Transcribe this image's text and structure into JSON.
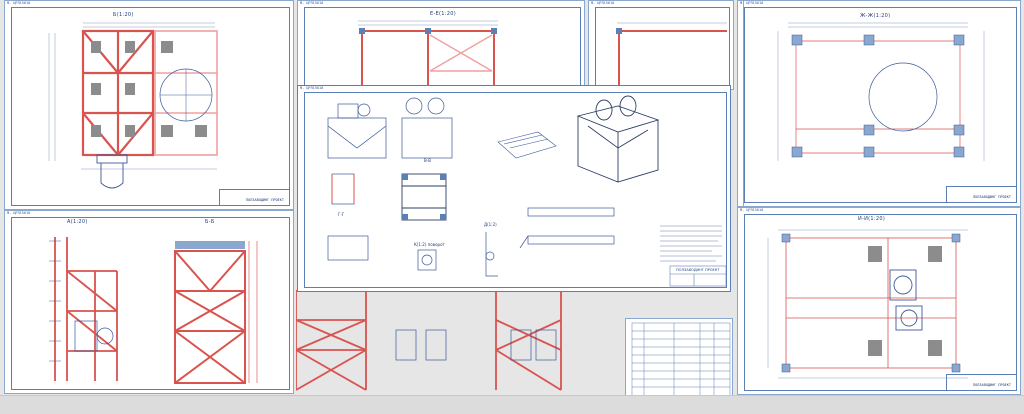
{
  "colors": {
    "frame_line": "#5b7fb7",
    "steel_red": "#d9534f",
    "steel_pink": "#f0a0a0",
    "outline": "#3d5a99",
    "dimension": "#6a7fa8",
    "hatch_grey": "#8c8c8c"
  },
  "sheets": {
    "top_left": {
      "stamp": "Ф. ЦРЛ15010",
      "title": "Б(1:20)",
      "tblock": "ПОЛЗАВОДИНГ ПРОЕКТ"
    },
    "top_mid": {
      "stamp": "Ф. ЦРЛ15010",
      "title": "Е-Е(1:20)"
    },
    "top_mid_right": {
      "stamp": "Ф. ЦРЛ15010"
    },
    "top_right": {
      "stamp": "Ф. ЦРЛ15010",
      "title": "Ж-Ж(1:20)",
      "tblock": "ПОЛЗАВОДИНГ ПРОЕКТ"
    },
    "center": {
      "stamp": "Ф. ЦРЛ15010",
      "view_vv": "В-В",
      "view_gg": "Г-Г",
      "view_d": "Д(1:2)",
      "view_k": "К(1:2) поворот",
      "tblock": "ПОЛЗАВОДИНГ ПРОЕКТ"
    },
    "bottom_left": {
      "stamp": "Ф. ЦРЛ15010",
      "title_a": "А(1:20)",
      "title_b": "Б-Б",
      "tblock": ""
    },
    "bottom_right": {
      "stamp": "Ф. ЦРЛ15010",
      "title": "И-И(1:20)",
      "tblock": "ПОЛЗАВОДИНГ ПРОЕКТ"
    }
  }
}
